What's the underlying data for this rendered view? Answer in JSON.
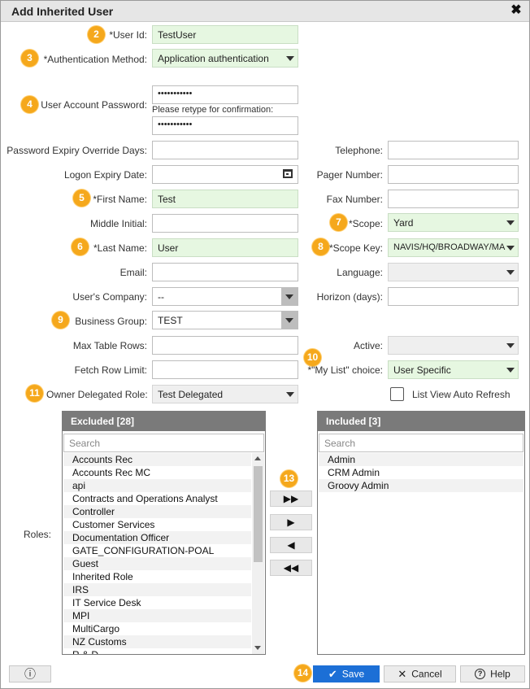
{
  "dialog": {
    "title": "Add Inherited User"
  },
  "form": {
    "user_id": {
      "badge": "2",
      "label": "*User Id:",
      "value": "TestUser"
    },
    "auth_method": {
      "badge": "3",
      "label": "*Authentication Method:",
      "value": "Application authentication"
    },
    "password": {
      "badge": "4",
      "label": "User Account Password:",
      "value": "•••••••••••",
      "confirm_label": "Please retype for confirmation:",
      "confirm_value": "•••••••••••"
    },
    "pwd_expiry": {
      "label": "Password Expiry Override Days:",
      "value": ""
    },
    "logon_expiry": {
      "label": "Logon Expiry Date:",
      "value": ""
    },
    "first_name": {
      "badge": "5",
      "label": "*First Name:",
      "value": "Test"
    },
    "middle_initial": {
      "label": "Middle Initial:",
      "value": ""
    },
    "last_name": {
      "badge": "6",
      "label": "*Last Name:",
      "value": "User"
    },
    "email": {
      "label": "Email:",
      "value": ""
    },
    "company": {
      "label": "User's Company:",
      "value": "--"
    },
    "business_group": {
      "badge": "9",
      "label": "Business Group:",
      "value": "TEST"
    },
    "max_table_rows": {
      "label": "Max Table Rows:",
      "value": ""
    },
    "fetch_row_limit": {
      "label": "Fetch Row Limit:",
      "value": ""
    },
    "owner_role": {
      "badge": "11",
      "label": "Owner Delegated Role:",
      "value": "Test Delegated"
    },
    "telephone": {
      "label": "Telephone:",
      "value": ""
    },
    "pager": {
      "label": "Pager Number:",
      "value": ""
    },
    "fax": {
      "label": "Fax Number:",
      "value": ""
    },
    "scope": {
      "badge": "7",
      "label": "*Scope:",
      "value": "Yard"
    },
    "scope_key": {
      "badge": "8",
      "label": "*Scope Key:",
      "value": "NAVIS/HQ/BROADWAY/MA"
    },
    "language": {
      "label": "Language:",
      "value": ""
    },
    "horizon": {
      "label": "Horizon (days):",
      "value": ""
    },
    "active": {
      "label": "Active:",
      "value": ""
    },
    "my_list": {
      "badge": "10",
      "label": "*\"My List\" choice:",
      "value": "User Specific"
    },
    "auto_refresh": {
      "label": "List View Auto Refresh",
      "checked": false
    }
  },
  "roles": {
    "label": "Roles:",
    "excluded": {
      "title": "Excluded [28]",
      "search_placeholder": "Search",
      "items": [
        "Accounts Rec",
        "Accounts Rec MC",
        "api",
        "Contracts and Operations Analyst",
        "Controller",
        "Customer Services",
        "Documentation Officer",
        "GATE_CONFIGURATION-POAL",
        "Guest",
        "Inherited Role",
        "IRS",
        "IT Service Desk",
        "MPI",
        "MultiCargo",
        "NZ Customs",
        "R & D"
      ]
    },
    "included": {
      "title": "Included [3]",
      "search_placeholder": "Search",
      "items": [
        "Admin",
        "CRM Admin",
        "Groovy Admin"
      ]
    },
    "transfer_badge": "13",
    "buttons": {
      "add_all": "▶▶",
      "add": "▶",
      "remove": "◀",
      "remove_all": "◀◀"
    }
  },
  "footer": {
    "info_glyph": "ⓘ",
    "save_badge": "14",
    "save_label": "Save",
    "cancel_label": "Cancel",
    "help_label": "Help"
  },
  "icons": {
    "close": "close-icon",
    "calendar": "calendar-icon",
    "check": "check-icon",
    "x": "x-icon",
    "help": "help-icon",
    "info": "info-icon"
  },
  "colors": {
    "required_bg": "#e6f7e1",
    "badge": "#f5a81c",
    "primary": "#1c6fd6",
    "panel_header": "#7a7a7a"
  }
}
